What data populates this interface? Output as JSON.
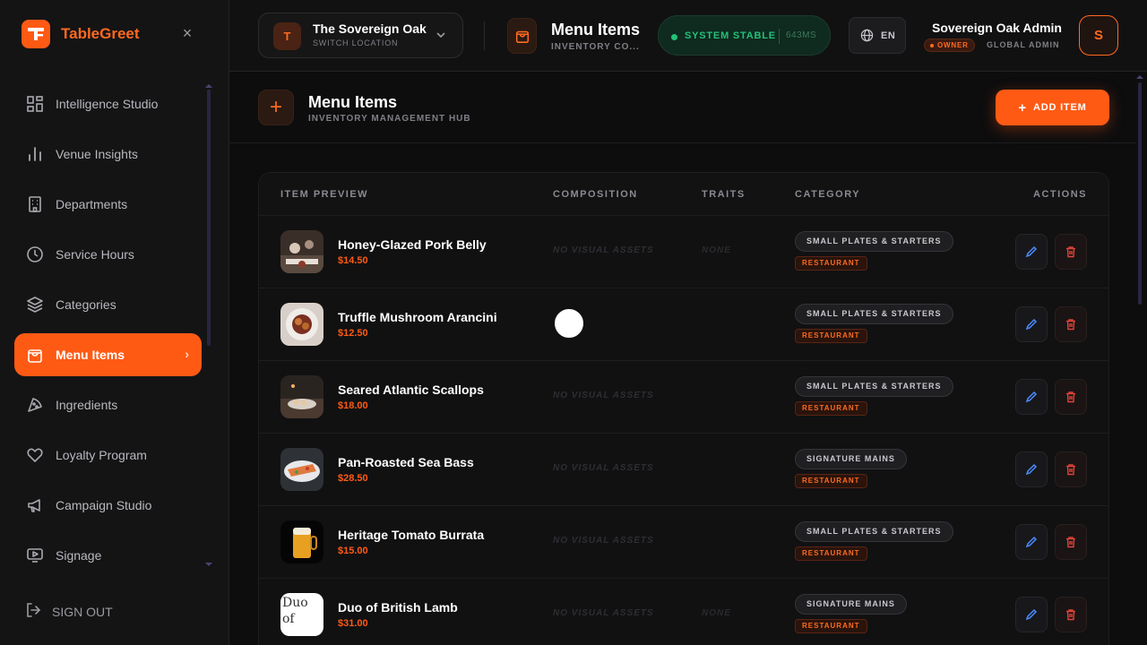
{
  "brand": {
    "name": "TableGreet",
    "logo_letter": "T",
    "accent": "#ff5a14"
  },
  "sidebar": {
    "items": [
      {
        "label": "Intelligence Studio",
        "icon": "grid-icon"
      },
      {
        "label": "Venue Insights",
        "icon": "bar-chart-icon"
      },
      {
        "label": "Departments",
        "icon": "building-icon"
      },
      {
        "label": "Service Hours",
        "icon": "clock-icon"
      },
      {
        "label": "Categories",
        "icon": "layers-icon"
      },
      {
        "label": "Menu Items",
        "icon": "shopping-bag-icon",
        "active": true
      },
      {
        "label": "Ingredients",
        "icon": "pizza-slice-icon"
      },
      {
        "label": "Loyalty Program",
        "icon": "heart-icon"
      },
      {
        "label": "Campaign Studio",
        "icon": "megaphone-icon"
      },
      {
        "label": "Signage",
        "icon": "display-icon"
      }
    ],
    "signout_label": "SIGN OUT"
  },
  "topbar": {
    "location": {
      "badge": "T",
      "name": "The Sovereign Oak",
      "sub": "SWITCH LOCATION"
    },
    "page": {
      "title": "Menu Items",
      "sub": "INVENTORY CO..."
    },
    "status": {
      "label": "SYSTEM STABLE",
      "latency": "643MS",
      "color": "#22c178"
    },
    "language": "EN",
    "user": {
      "name": "Sovereign Oak Admin",
      "role": "OWNER",
      "scope": "GLOBAL ADMIN",
      "initial": "S"
    }
  },
  "main": {
    "title": "Menu Items",
    "subtitle": "INVENTORY MANAGEMENT HUB",
    "add_button": "ADD ITEM",
    "columns": [
      "ITEM PREVIEW",
      "COMPOSITION",
      "TRAITS",
      "CATEGORY",
      "ACTIONS"
    ],
    "rows": [
      {
        "name": "Honey-Glazed Pork Belly",
        "price": "$14.50",
        "composition": "NO VISUAL ASSETS",
        "traits": "NONE",
        "category": "SMALL PLATES & STARTERS",
        "type": "RESTAURANT"
      },
      {
        "name": "Truffle Mushroom Arancini",
        "price": "$12.50",
        "composition": "",
        "traits": "",
        "category": "SMALL PLATES & STARTERS",
        "type": "RESTAURANT"
      },
      {
        "name": "Seared Atlantic Scallops",
        "price": "$18.00",
        "composition": "NO VISUAL ASSETS",
        "traits": "",
        "category": "SMALL PLATES & STARTERS",
        "type": "RESTAURANT"
      },
      {
        "name": "Pan-Roasted Sea Bass",
        "price": "$28.50",
        "composition": "NO VISUAL ASSETS",
        "traits": "",
        "category": "SIGNATURE MAINS",
        "type": "RESTAURANT"
      },
      {
        "name": "Heritage Tomato Burrata",
        "price": "$15.00",
        "composition": "NO VISUAL ASSETS",
        "traits": "",
        "category": "SMALL PLATES & STARTERS",
        "type": "RESTAURANT"
      },
      {
        "name": "Duo of British Lamb",
        "price": "$31.00",
        "composition": "NO VISUAL ASSETS",
        "traits": "NONE",
        "category": "SIGNATURE MAINS",
        "type": "RESTAURANT",
        "broken_image_alt": "Duo of"
      }
    ]
  }
}
